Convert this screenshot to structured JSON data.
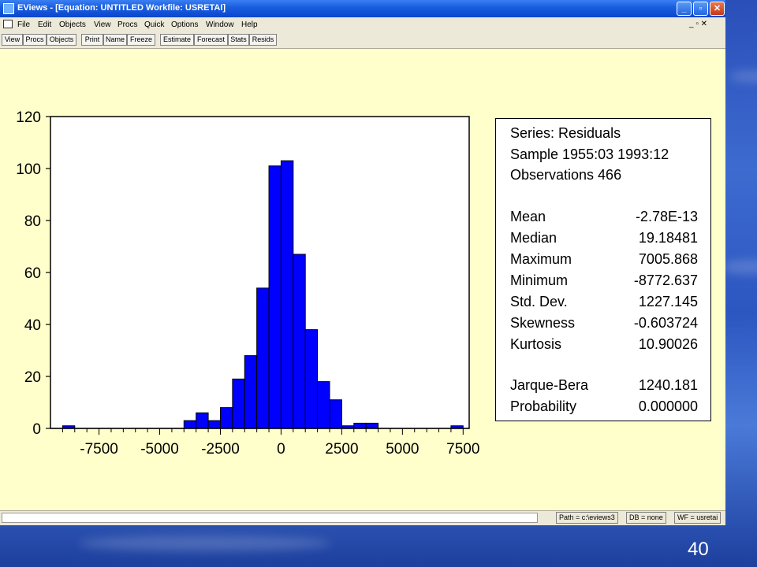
{
  "window": {
    "title": "EViews - [Equation: UNTITLED    Workfile: USRETAI]",
    "min_label": "_",
    "max_label": "▫",
    "close_label": "✕"
  },
  "menu": {
    "items": [
      "File",
      "Edit",
      "Objects",
      "View",
      "Procs",
      "Quick",
      "Options",
      "Window",
      "Help"
    ],
    "mdi_controls": "_ ▫ ✕"
  },
  "toolbar": {
    "buttons": [
      "View",
      "Procs",
      "Objects",
      "Print",
      "Name",
      "Freeze",
      "Estimate",
      "Forecast",
      "Stats",
      "Resids"
    ]
  },
  "status": {
    "path": "Path = c:\\eviews3",
    "db": "DB = none",
    "wf": "WF = usretai"
  },
  "stats": {
    "series": "Series: Residuals",
    "sample": "Sample 1955:03 1993:12",
    "observations": "Observations 466",
    "rows": [
      {
        "label": "Mean",
        "value": "-2.78E-13"
      },
      {
        "label": "Median",
        "value": "19.18481"
      },
      {
        "label": "Maximum",
        "value": "7005.868"
      },
      {
        "label": "Minimum",
        "value": "-8772.637"
      },
      {
        "label": "Std. Dev.",
        "value": "1227.145"
      },
      {
        "label": "Skewness",
        "value": "-0.603724"
      },
      {
        "label": "Kurtosis",
        "value": "10.90026"
      }
    ],
    "jb_rows": [
      {
        "label": "Jarque-Bera",
        "value": "1240.181"
      },
      {
        "label": "Probability",
        "value": "0.000000"
      }
    ]
  },
  "chart_data": {
    "type": "bar",
    "title": "",
    "xlabel": "",
    "ylabel": "",
    "bar_color": "#0000ff",
    "bin_width": 500,
    "bins": [
      {
        "start": -9000,
        "value": 1
      },
      {
        "start": -8500,
        "value": 0
      },
      {
        "start": -8000,
        "value": 0
      },
      {
        "start": -7500,
        "value": 0
      },
      {
        "start": -7000,
        "value": 0
      },
      {
        "start": -6500,
        "value": 0
      },
      {
        "start": -6000,
        "value": 0
      },
      {
        "start": -5500,
        "value": 0
      },
      {
        "start": -5000,
        "value": 0
      },
      {
        "start": -4500,
        "value": 0
      },
      {
        "start": -4000,
        "value": 3
      },
      {
        "start": -3500,
        "value": 6
      },
      {
        "start": -3000,
        "value": 3
      },
      {
        "start": -2500,
        "value": 8
      },
      {
        "start": -2000,
        "value": 19
      },
      {
        "start": -1500,
        "value": 28
      },
      {
        "start": -1000,
        "value": 54
      },
      {
        "start": -500,
        "value": 101
      },
      {
        "start": 0,
        "value": 103
      },
      {
        "start": 500,
        "value": 67
      },
      {
        "start": 1000,
        "value": 38
      },
      {
        "start": 1500,
        "value": 18
      },
      {
        "start": 2000,
        "value": 11
      },
      {
        "start": 2500,
        "value": 1
      },
      {
        "start": 3000,
        "value": 2
      },
      {
        "start": 3500,
        "value": 2
      },
      {
        "start": 4000,
        "value": 0
      },
      {
        "start": 4500,
        "value": 0
      },
      {
        "start": 5000,
        "value": 0
      },
      {
        "start": 5500,
        "value": 0
      },
      {
        "start": 6000,
        "value": 0
      },
      {
        "start": 6500,
        "value": 0
      },
      {
        "start": 7000,
        "value": 1
      }
    ],
    "xlim": [
      -9500,
      7750
    ],
    "ylim": [
      0,
      120
    ],
    "x_ticks": [
      "-7500",
      "-5000",
      "-2500",
      "0",
      "2500",
      "5000",
      "7500"
    ],
    "y_ticks": [
      "0",
      "20",
      "40",
      "60",
      "80",
      "100",
      "120"
    ],
    "grid": false
  },
  "slide_number": "40",
  "colors": {
    "plot_background": "#ffffcc",
    "titlebar": "#0a46cc",
    "bars": "#0000ff"
  }
}
